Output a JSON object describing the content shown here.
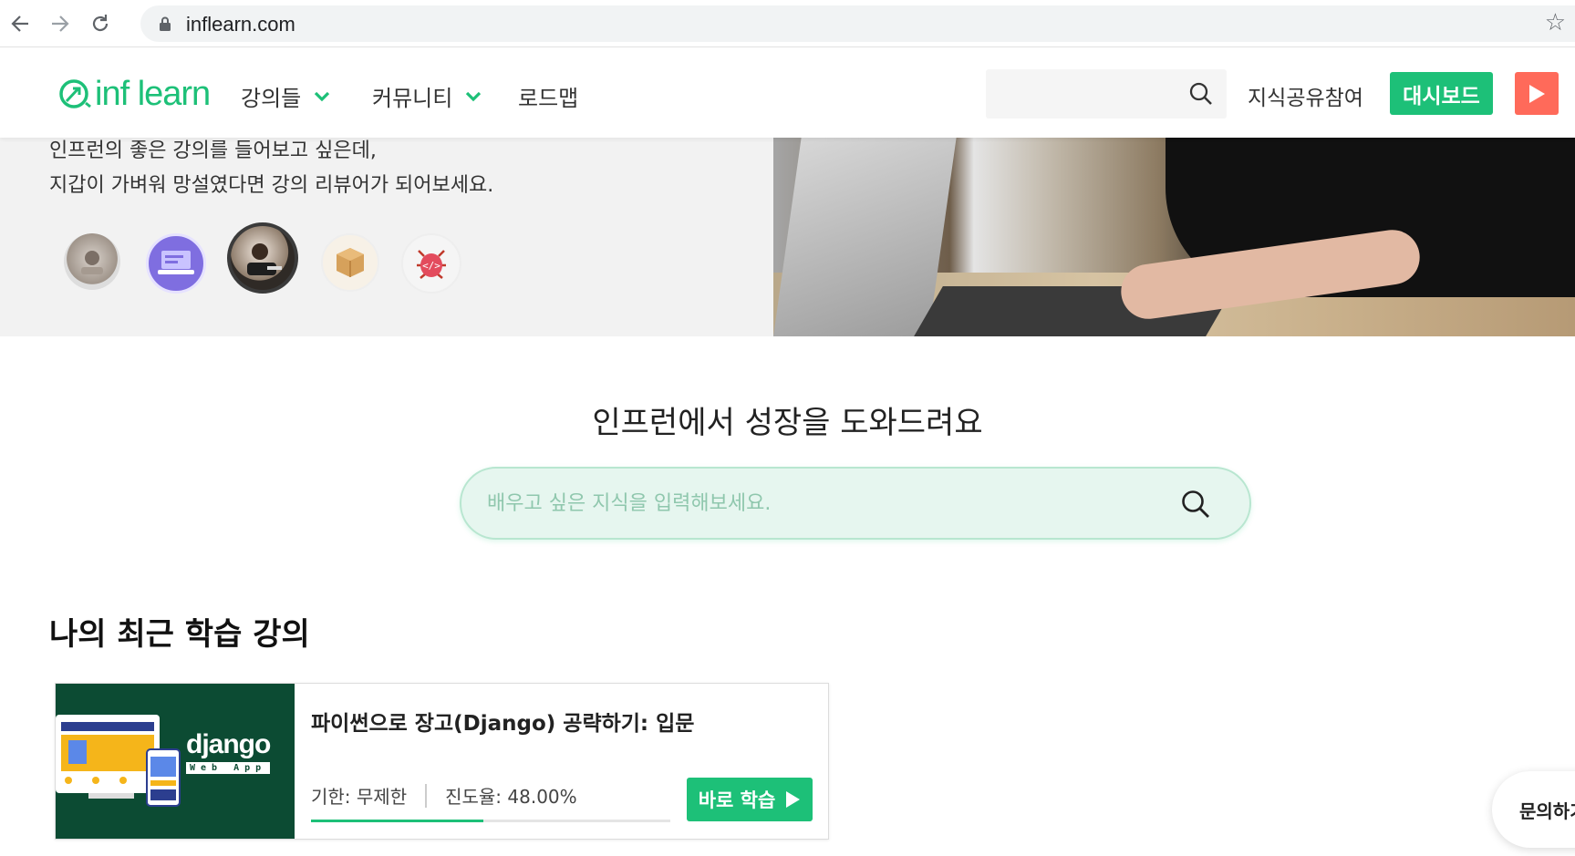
{
  "browser": {
    "url": "inflearn.com",
    "icons": [
      "back-arrow-icon",
      "forward-arrow-icon",
      "reload-icon",
      "lock-icon",
      "star-icon"
    ]
  },
  "header": {
    "logo_text": "inf learn",
    "menu": [
      {
        "label": "강의들",
        "has_dropdown": true
      },
      {
        "label": "커뮤니티",
        "has_dropdown": true
      },
      {
        "label": "로드맵",
        "has_dropdown": false
      }
    ],
    "search_placeholder": "",
    "share_label": "지식공유참여",
    "dashboard_label": "대시보드",
    "brand_color": "#1dc078",
    "play_color": "#ff6a5a"
  },
  "hero": {
    "line1": "인프런의 좋은 강의를 들어보고 싶은데,",
    "line2": "지갑이 가벼워 망설였다면 강의 리뷰어가 되어보세요.",
    "avatars": [
      "avatar-1",
      "avatar-2",
      "avatar-3-selected",
      "avatar-4",
      "avatar-5"
    ]
  },
  "growth": {
    "title": "인프런에서 성장을 도와드려요",
    "search_placeholder": "배우고 싶은 지식을 입력해보세요."
  },
  "recent": {
    "title": "나의 최근 학습 강의",
    "courses": [
      {
        "title": "파이썬으로 장고(Django) 공략하기: 입문",
        "thumb_title": "django",
        "thumb_subtitle": "Web App",
        "deadline": "기한: 무제한",
        "progress_text": "진도율: 48.00%",
        "progress": 0.48,
        "button_label": "바로 학습"
      }
    ]
  },
  "inquiry_label": "문의하기"
}
